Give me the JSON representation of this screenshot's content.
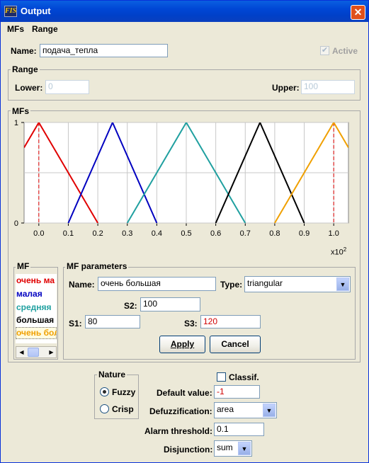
{
  "window": {
    "title": "Output",
    "icon_text": "FIS",
    "close_symbol": "✕"
  },
  "menu": {
    "items": [
      "MFs",
      "Range"
    ]
  },
  "name_row": {
    "label": "Name:",
    "value": "подача_тепла",
    "active_label": "Active",
    "active_checked": true
  },
  "range": {
    "title": "Range",
    "lower_label": "Lower:",
    "lower_value": "0",
    "upper_label": "Upper:",
    "upper_value": "100"
  },
  "mfs": {
    "title": "MFs",
    "exponent_label": "x10",
    "exponent_sup": "2"
  },
  "chart_data": {
    "type": "line",
    "xlim": [
      -0.05,
      1.05
    ],
    "ylim": [
      0,
      1
    ],
    "x_ticks": [
      "0.0",
      "0.1",
      "0.2",
      "0.3",
      "0.4",
      "0.5",
      "0.6",
      "0.7",
      "0.8",
      "0.9",
      "1.0"
    ],
    "y_ticks": [
      "0",
      "1"
    ],
    "x_multiplier": "x10^2",
    "grid": true,
    "series": [
      {
        "name": "очень малая",
        "color": "#e00000",
        "points": [
          [
            -0.05,
            0.75
          ],
          [
            0.0,
            1.0
          ],
          [
            0.2,
            0.0
          ]
        ]
      },
      {
        "name": "малая",
        "color": "#0000c0",
        "points": [
          [
            0.1,
            0.0
          ],
          [
            0.25,
            1.0
          ],
          [
            0.4,
            0.0
          ]
        ]
      },
      {
        "name": "средняя",
        "color": "#20a0a0",
        "points": [
          [
            0.3,
            0.0
          ],
          [
            0.5,
            1.0
          ],
          [
            0.7,
            0.0
          ]
        ]
      },
      {
        "name": "большая",
        "color": "#000000",
        "points": [
          [
            0.6,
            0.0
          ],
          [
            0.75,
            1.0
          ],
          [
            0.9,
            0.0
          ]
        ]
      },
      {
        "name": "очень большая",
        "color": "#f0a000",
        "points": [
          [
            0.8,
            0.0
          ],
          [
            1.0,
            1.0
          ],
          [
            1.05,
            0.75
          ]
        ]
      }
    ],
    "selected_series_marker_x": [
      0.0,
      1.0
    ]
  },
  "mf_list": {
    "title": "MF",
    "items": [
      {
        "label": "очень ма",
        "color": "#e00000"
      },
      {
        "label": "малая",
        "color": "#0000c0"
      },
      {
        "label": "средняя",
        "color": "#20a0a0"
      },
      {
        "label": "большая",
        "color": "#000000"
      },
      {
        "label": "очень бол",
        "color": "#f0a000"
      }
    ]
  },
  "mf_params": {
    "title": "MF parameters",
    "name_label": "Name:",
    "name_value": "очень большая",
    "type_label": "Type:",
    "type_value": "triangular",
    "s2_label": "S2:",
    "s2_value": "100",
    "s1_label": "S1:",
    "s1_value": "80",
    "s3_label": "S3:",
    "s3_value": "120",
    "apply_label": "Apply",
    "cancel_label": "Cancel"
  },
  "nature": {
    "title": "Nature",
    "fuzzy_label": "Fuzzy",
    "crisp_label": "Crisp",
    "selected": "Fuzzy"
  },
  "bottom": {
    "classif_label": "Classif.",
    "default_label": "Default value:",
    "default_value": "-1",
    "defuzz_label": "Defuzzification:",
    "defuzz_value": "area",
    "alarm_label": "Alarm threshold:",
    "alarm_value": "0.1",
    "disj_label": "Disjunction:",
    "disj_value": "sum"
  }
}
